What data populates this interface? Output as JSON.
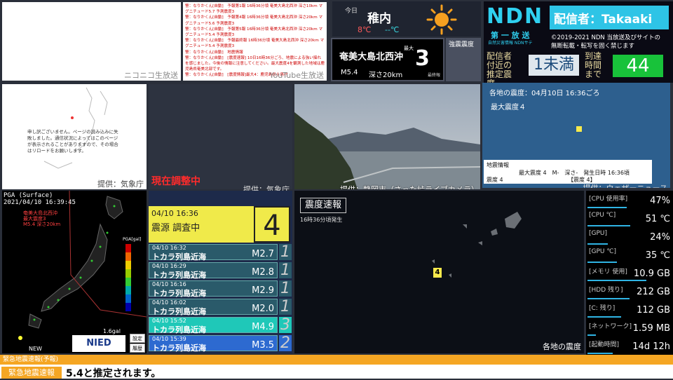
{
  "panels": {
    "niconico_caption": "ニコニコ生放送",
    "youtube_caption": "YouTube生放送",
    "youtube_chat": [
      "警：なりかくん[自動]　予報第1報 16時36分頃 奄美大島北西沖 深さ10km マグニチュード5.7 予測震度3",
      "警：なりかくん[自動]　予報第4報 16時36分頃 奄美大島北西沖 深さ20km マグニチュード5.6 予測震度3",
      "警：なりかくん[自動]　予報第5報 16時36分頃 奄美大島北西沖 深さ20km マグニチュード5.4 予測震度3",
      "警：なりかくん[自動]　予報最終報 16時36分頃 奄美大島北西沖 深さ20km マグニチュード5.4 予測震度3",
      "警：なりかくん[自動]　地震情報",
      "警：なりかくん[自動]　[震度速報] 10日16時36分ごろ、地震による強い揺れを感じました。今後の情報に注意してください。最大震度4を観測した地域は鹿児島県奄美北部です。",
      "警：なりかくん[自動]　[震度情報]最大4：鹿児島県十島村"
    ],
    "map1_caption": "提供：気象庁",
    "map1_message": "申し訳ございません。ページの読み込みに失敗しました。通信状況によってはこのページが表示されることがありますので、その場合はリロードをお願いします。",
    "blank_warning": "現在調整中",
    "blank_caption": "提供：気象庁",
    "camera_caption": "提供：静岡市（さった峠ライブカメラ）",
    "weathernews_caption": "提供：ウェザーニュース",
    "weathernews_title": "各地の震度：04月10日 16:36ごろ",
    "weathernews_max": "最大震度４",
    "weathernews_bar": [
      "地震情報",
      "最大震度 4　M-　深さ-　発生日時 16:36頃",
      "震度 4",
      "【震度 4】"
    ]
  },
  "weather": {
    "label": "今日",
    "city": "稚内",
    "high": "8℃",
    "low": "--℃",
    "icon": "sun-icon"
  },
  "quake_summary": {
    "place": "奄美大島北西沖",
    "max_label": "最大",
    "intensity": "3",
    "magnitude": "M5.4",
    "depth": "深さ20km",
    "final": "最終報",
    "strong_label": "強震震度"
  },
  "ndn": {
    "logo": "NDN",
    "subtitle": "第 一 放 送",
    "subtitle2": "自然災害情報 NDNサテ",
    "host": "配信者：Takaaki",
    "copyright": [
      "©2019-2021 NDN 当放送及びサイトの",
      "無断転載・転写を固く禁じます"
    ],
    "est_label": "配信者付近の推定震度",
    "est_value": "1未満",
    "arrival_label": "到達時間まで",
    "arrival_value": "44"
  },
  "pga": {
    "title": "PGA (Surface)",
    "time": "2021/04/10 16:39:45",
    "label_lines": [
      "奄美大島北西沖",
      "最大震度3",
      "M5.4 深さ20km"
    ],
    "unit": "PGA[gal]",
    "min": "1.6gal",
    "new": "NEW",
    "logo": "NIED",
    "buttons": [
      "設定",
      "履歴"
    ]
  },
  "quake_list": {
    "top": {
      "time": "04/10 16:36",
      "source": "震源 調査中",
      "intensity": "4"
    },
    "rows": [
      {
        "time": "04/10 16:32",
        "region": "トカラ列島近海",
        "mag": "M2.7",
        "int": "1",
        "color": "#2a5a6a"
      },
      {
        "time": "04/10 16:29",
        "region": "トカラ列島近海",
        "mag": "M2.8",
        "int": "1",
        "color": "#2a5a6a"
      },
      {
        "time": "04/10 16:16",
        "region": "トカラ列島近海",
        "mag": "M2.9",
        "int": "1",
        "color": "#2a5a6a"
      },
      {
        "time": "04/10 16:02",
        "region": "トカラ列島近海",
        "mag": "M2.0",
        "int": "1",
        "color": "#2a5a6a"
      },
      {
        "time": "04/10 15:52",
        "region": "トカラ列島近海",
        "mag": "M4.9",
        "int": "3",
        "color": "#1fc8b8"
      },
      {
        "time": "04/10 15:39",
        "region": "トカラ列島近海",
        "mag": "M3.5",
        "int": "2",
        "color": "#2d6ad0"
      }
    ]
  },
  "report": {
    "title": "震度速報",
    "subtitle": "16時36分頃発生",
    "caption": "各地の震度",
    "marker": "4"
  },
  "stats": [
    {
      "label": "[CPU 使用率]",
      "value": "47%",
      "fill": 0.47
    },
    {
      "label": "[CPU ℃]",
      "value": "51 ℃",
      "fill": 0.51
    },
    {
      "label": "[GPU]",
      "value": "24%",
      "fill": 0.24
    },
    {
      "label": "[GPU ℃]",
      "value": "35 ℃",
      "fill": 0.35
    },
    {
      "label": "[メモリ 使用]",
      "value": "10.9 GB",
      "fill": 0.7
    },
    {
      "label": "[HDD 残り]",
      "value": "212 GB",
      "fill": 0.5
    },
    {
      "label": "[C: 残り]",
      "value": "112 GB",
      "fill": 0.4
    },
    {
      "label": "[ネットワーク]",
      "value": "1.59 MB",
      "fill": 0.1
    },
    {
      "label": "[起動時間]",
      "value": "14d 12h",
      "fill": 0.3
    }
  ],
  "banner": {
    "head": "緊急地震速報(予報)",
    "tag": "緊急地震速報",
    "text": "5.4と推定されます。"
  }
}
